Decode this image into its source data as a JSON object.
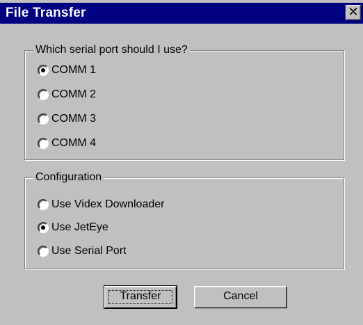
{
  "window": {
    "title": "File Transfer",
    "close_glyph": "✕"
  },
  "serial_port_group": {
    "legend": "Which serial port should I use?",
    "options": [
      {
        "label": "COMM 1",
        "checked": true
      },
      {
        "label": "COMM 2",
        "checked": false
      },
      {
        "label": "COMM 3",
        "checked": false
      },
      {
        "label": "COMM 4",
        "checked": false
      }
    ]
  },
  "configuration_group": {
    "legend": "Configuration",
    "options": [
      {
        "label": "Use Videx Downloader",
        "checked": false
      },
      {
        "label": "Use JetEye",
        "checked": true
      },
      {
        "label": "Use Serial Port",
        "checked": false
      }
    ]
  },
  "buttons": {
    "transfer_label": "Transfer",
    "cancel_label": "Cancel"
  },
  "colors": {
    "titlebar": "#000080",
    "face": "#c0c0c0"
  }
}
